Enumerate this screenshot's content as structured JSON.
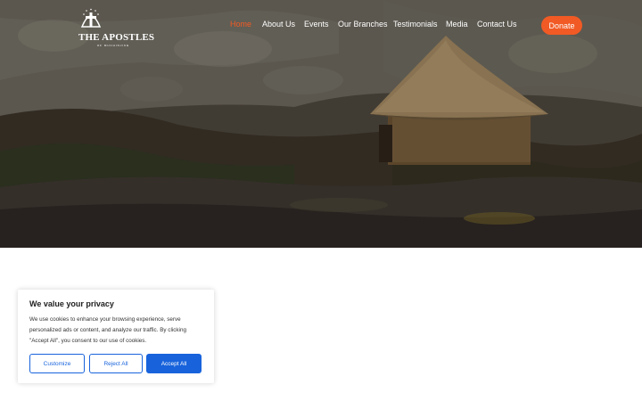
{
  "header": {
    "logo_title": "THE APOSTLES",
    "logo_subtitle": "OF MUCHINJIKE",
    "nav": [
      {
        "label": "Home"
      },
      {
        "label": "About Us"
      },
      {
        "label": "Events"
      },
      {
        "label": "Our Branches"
      },
      {
        "label": "Testimonials"
      },
      {
        "label": "Media"
      },
      {
        "label": "Contact Us"
      }
    ],
    "donate_label": "Donate"
  },
  "hero": {
    "image": "rocky-hillside-with-thatched-hut"
  },
  "cookie_banner": {
    "title": "We value your privacy",
    "text": "We use cookies to enhance your browsing experience, serve personalized ads or content, and analyze our traffic. By clicking \"Accept All\", you consent to our use of cookies.",
    "customize_label": "Customize",
    "reject_label": "Reject All",
    "accept_label": "Accept All"
  },
  "colors": {
    "accent": "#f15a24",
    "cookie_button": "#1863dc"
  }
}
